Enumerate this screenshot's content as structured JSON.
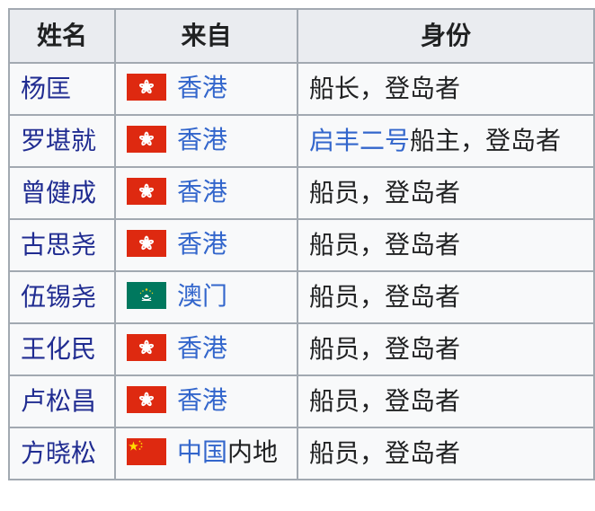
{
  "headers": {
    "name": "姓名",
    "from": "来自",
    "identity": "身份"
  },
  "rows": [
    {
      "name": "杨匡",
      "flag": "hong-kong-flag",
      "from_link": "香港",
      "from_suffix": "",
      "identity_link": "",
      "identity_text": "船长，登岛者"
    },
    {
      "name": "罗堪就",
      "flag": "hong-kong-flag",
      "from_link": "香港",
      "from_suffix": "",
      "identity_link": "启丰二号",
      "identity_text": "船主，登岛者"
    },
    {
      "name": "曾健成",
      "flag": "hong-kong-flag",
      "from_link": "香港",
      "from_suffix": "",
      "identity_link": "",
      "identity_text": "船员，登岛者"
    },
    {
      "name": "古思尧",
      "flag": "hong-kong-flag",
      "from_link": "香港",
      "from_suffix": "",
      "identity_link": "",
      "identity_text": "船员，登岛者"
    },
    {
      "name": "伍锡尧",
      "flag": "macau-flag",
      "from_link": "澳门",
      "from_suffix": "",
      "identity_link": "",
      "identity_text": "船员，登岛者"
    },
    {
      "name": "王化民",
      "flag": "hong-kong-flag",
      "from_link": "香港",
      "from_suffix": "",
      "identity_link": "",
      "identity_text": "船员，登岛者"
    },
    {
      "name": "卢松昌",
      "flag": "hong-kong-flag",
      "from_link": "香港",
      "from_suffix": "",
      "identity_link": "",
      "identity_text": "船员，登岛者"
    },
    {
      "name": "方晓松",
      "flag": "china-flag",
      "from_link": "中国",
      "from_suffix": "内地",
      "identity_link": "",
      "identity_text": "船员，登岛者"
    }
  ],
  "colors": {
    "link": "#3366cc",
    "name_link": "#202c91",
    "border": "#a2a9b1",
    "header_bg": "#eaecf0",
    "cell_bg": "#f8f9fa"
  }
}
